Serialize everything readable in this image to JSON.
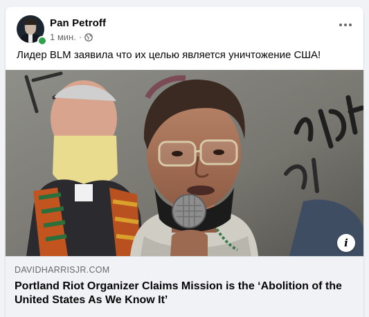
{
  "post": {
    "author": "Pan Petroff",
    "time": "1 мин.",
    "separator": "·",
    "privacy_icon": "globe-icon",
    "more_icon": "more-options-icon",
    "text": "Лидер BLM заявила что их целью является уничтожение США!"
  },
  "link_preview": {
    "domain": "DAVIDHARRISJR.COM",
    "title": "Portland Riot Organizer Claims Mission is the ‘Abolition of the United States As We Know It’",
    "info_label": "i"
  },
  "colors": {
    "online": "#31a24c",
    "text_primary": "#050505",
    "text_secondary": "#65676b",
    "preview_bg": "#f0f2f5"
  }
}
